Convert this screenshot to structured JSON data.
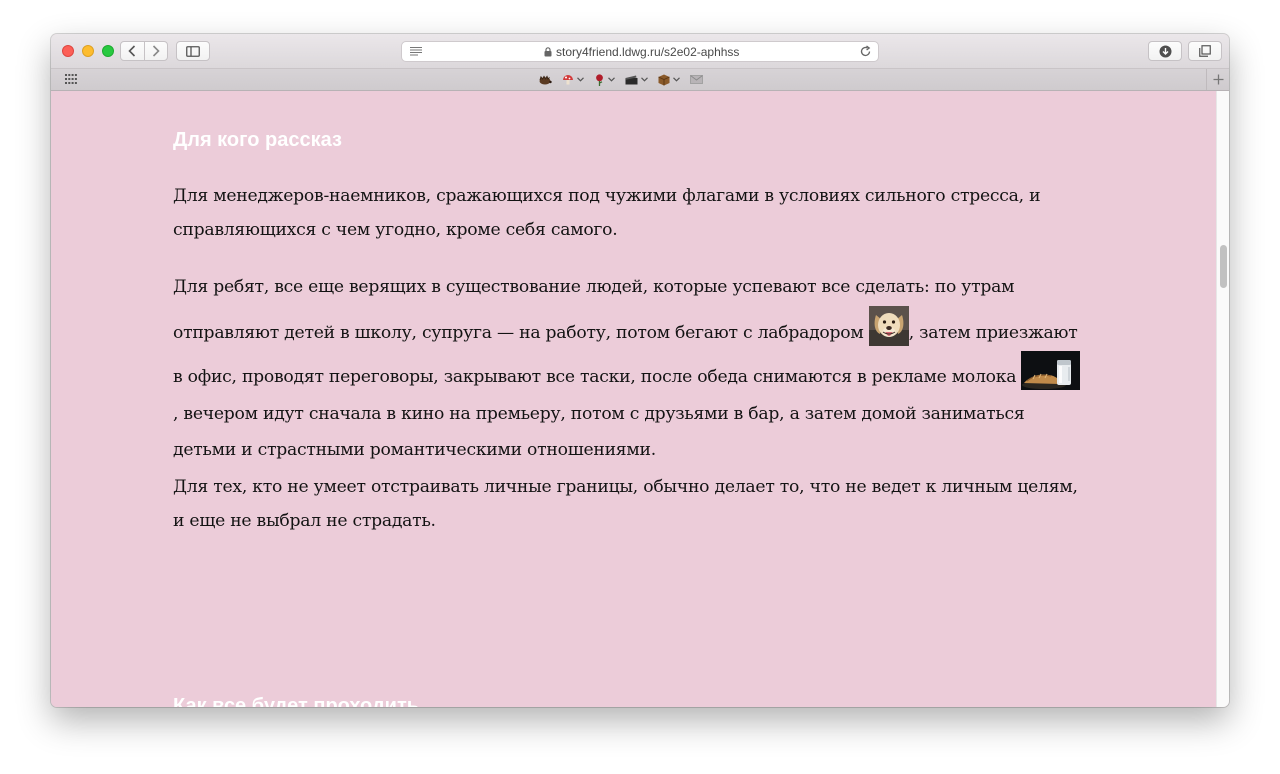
{
  "browser": {
    "url": "story4friend.ldwg.ru/s2e02-aphhss",
    "favorites": [
      {
        "icon": "hedgehog-icon",
        "has_menu": false,
        "color": "#5a3a22"
      },
      {
        "icon": "mushroom-icon",
        "has_menu": true,
        "color": "#d23a3a"
      },
      {
        "icon": "rose-icon",
        "has_menu": true,
        "color": "#b01d2a"
      },
      {
        "icon": "clapperboard-icon",
        "has_menu": true,
        "color": "#2a2a2a"
      },
      {
        "icon": "box-icon",
        "has_menu": true,
        "color": "#8a5a2a"
      },
      {
        "icon": "envelope-icon",
        "has_menu": false,
        "color": "#9a9a9a"
      }
    ]
  },
  "page": {
    "heading1": "Для кого рассказ",
    "para1": "Для менеджеров-наемников, сражающихся под чужими флагами в условиях сильного стресса, и справляющихся с чем угодно, кроме себя самого.",
    "para2": {
      "part1": "Для ребят, все еще верящих в существование людей, которые успевают все сделать: по утрам отправляют детей в школу, супруга — на работу, потом бегают с лабрадором ",
      "part2": ", затем приез­жают в офис, проводят переговоры, закрывают все таски, после обеда снимаются в рекламе молока ",
      "part3": ", вечером идут сначала в кино на премьеру, потом с друзьями в бар, а затем домой заниматься детьми и страстными романтическими отношениями."
    },
    "para3": "Для тех, кто не умеет отстраивать личные границы, обычно делает то, что не ведет к личным целям, и еще не выбрал не страдать.",
    "heading2": "Как все будет проходить"
  },
  "colors": {
    "page_bg": "#ecccd9",
    "heading": "#ffffff",
    "text": "#131313"
  }
}
